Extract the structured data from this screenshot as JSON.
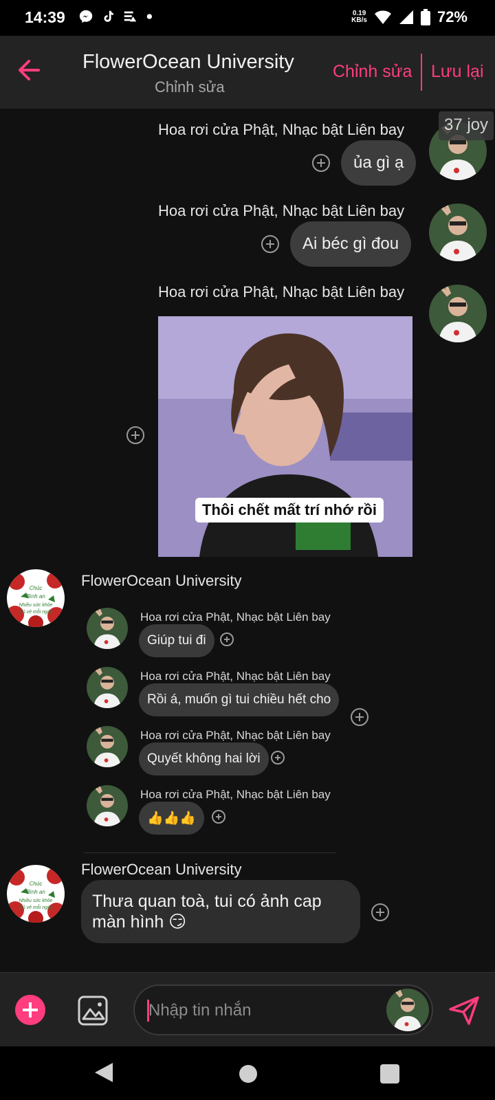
{
  "status_bar": {
    "time": "14:39",
    "net_speed_value": "0.19",
    "net_speed_unit": "KB/s",
    "battery": "72%",
    "icons": [
      "messenger-icon",
      "tiktok-icon",
      "data-saver-icon",
      "dot-icon",
      "wifi-icon",
      "signal-icon",
      "battery-icon"
    ]
  },
  "header": {
    "title": "FlowerOcean University",
    "subtitle": "Chỉnh sửa",
    "edit_label": "Chỉnh sửa",
    "save_label": "Lưu lại",
    "accent_color": "#ff3d7f"
  },
  "messages": [
    {
      "sender": "Hoa rơi cửa Phật, Nhạc bật Liên bay",
      "text": "ủa gì ạ"
    },
    {
      "sender": "Hoa rơi cửa Phật, Nhạc bật Liên bay",
      "text": "Ai béc gì đou"
    },
    {
      "sender": "Hoa rơi cửa Phật, Nhạc bật Liên bay",
      "meme_caption": "Thôi chết mất trí nhớ rồi"
    },
    {
      "sender": "FlowerOcean University",
      "avatar_text": "Chúc Bình an Nhiều sức khỏe Đủ vẻ mỗi ngày",
      "quoted": [
        {
          "sender": "Hoa rơi cửa Phật, Nhạc bật Liên bay",
          "text": "Giúp tui đi"
        },
        {
          "sender": "Hoa rơi cửa Phật, Nhạc bật Liên bay",
          "text": "Rồi á, muốn gì tui chiều hết cho"
        },
        {
          "sender": "Hoa rơi cửa Phật, Nhạc bật Liên bay",
          "text": "Quyết không hai lời"
        },
        {
          "sender": "Hoa rơi cửa Phật, Nhạc bật Liên bay",
          "text": "👍👍👍"
        }
      ]
    },
    {
      "sender": "FlowerOcean University",
      "text_line1": "Thưa quan toà, tui có ảnh cap",
      "text_line2": "màn hình 😏"
    }
  ],
  "reaction_tag": "37 joy",
  "composer": {
    "placeholder": "Nhập tin nhắn"
  }
}
